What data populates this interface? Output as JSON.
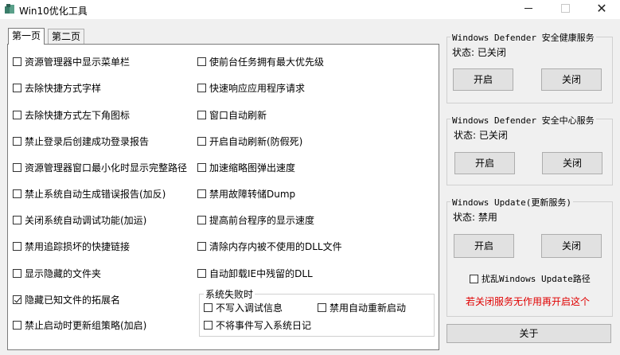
{
  "window": {
    "title": "Win10优化工具",
    "min_label": "",
    "max_label": "",
    "close_label": "✕"
  },
  "tabs": [
    {
      "label": "第一页"
    },
    {
      "label": "第二页"
    }
  ],
  "left_col": [
    {
      "label": "资源管理器中显示菜单栏",
      "checked": false
    },
    {
      "label": "去除快捷方式字样",
      "checked": false
    },
    {
      "label": "去除快捷方式左下角图标",
      "checked": false
    },
    {
      "label": "禁止登录后创建成功登录报告",
      "checked": false
    },
    {
      "label": "资源管理器窗口最小化时显示完整路径",
      "checked": false
    },
    {
      "label": "禁止系统自动生成错误报告(加反)",
      "checked": false
    },
    {
      "label": "关闭系统自动调试功能(加运)",
      "checked": false
    },
    {
      "label": "禁用追踪损坏的快捷链接",
      "checked": false
    },
    {
      "label": "显示隐藏的文件夹",
      "checked": false
    },
    {
      "label": "隐藏已知文件的拓展名",
      "checked": true
    },
    {
      "label": "禁止启动时更新组策略(加启)",
      "checked": false
    }
  ],
  "right_col": [
    {
      "label": "使前台任务拥有最大优先级",
      "checked": false
    },
    {
      "label": "快速响应应用程序请求",
      "checked": false
    },
    {
      "label": "窗口自动刷新",
      "checked": false
    },
    {
      "label": "开启自动刷新(防假死)",
      "checked": false
    },
    {
      "label": "加速缩略图弹出速度",
      "checked": false
    },
    {
      "label": "禁用故障转储Dump",
      "checked": false
    },
    {
      "label": "提高前台程序的显示速度",
      "checked": false
    },
    {
      "label": "清除内存内被不使用的DLL文件",
      "checked": false
    },
    {
      "label": "自动卸载IE中残留的DLL",
      "checked": false
    }
  ],
  "failure_group": {
    "title": "系统失败时",
    "items": [
      {
        "label": "不写入调试信息",
        "checked": false
      },
      {
        "label": "禁用自动重新启动",
        "checked": false
      },
      {
        "label": "不将事件写入系统日记",
        "checked": false
      }
    ]
  },
  "services": [
    {
      "title": "Windows Defender 安全健康服务",
      "status": "状态: 已关闭",
      "start_label": "开启",
      "stop_label": "关闭"
    },
    {
      "title": "Windows Defender 安全中心服务",
      "status": "状态: 已关闭",
      "start_label": "开启",
      "stop_label": "关闭"
    },
    {
      "title": "Windows Update(更新服务)",
      "status": "状态: 禁用",
      "start_label": "开启",
      "stop_label": "关闭"
    }
  ],
  "update_path": {
    "label": "扰乱Windows Update路径",
    "checked": false
  },
  "warning": "若关闭服务无作用再开启这个",
  "about_label": "关于",
  "colors": {
    "warning": "#e00000",
    "window_bg": "#f0f0f0",
    "button_bg": "#e1e1e1"
  }
}
